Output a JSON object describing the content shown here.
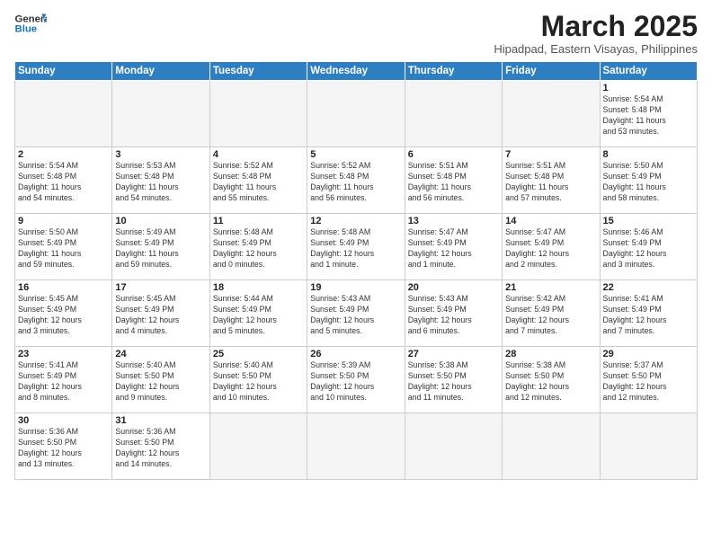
{
  "header": {
    "logo_general": "General",
    "logo_blue": "Blue",
    "month_title": "March 2025",
    "subtitle": "Hipadpad, Eastern Visayas, Philippines"
  },
  "days_of_week": [
    "Sunday",
    "Monday",
    "Tuesday",
    "Wednesday",
    "Thursday",
    "Friday",
    "Saturday"
  ],
  "weeks": [
    [
      {
        "num": "",
        "info": ""
      },
      {
        "num": "",
        "info": ""
      },
      {
        "num": "",
        "info": ""
      },
      {
        "num": "",
        "info": ""
      },
      {
        "num": "",
        "info": ""
      },
      {
        "num": "",
        "info": ""
      },
      {
        "num": "1",
        "info": "Sunrise: 5:54 AM\nSunset: 5:48 PM\nDaylight: 11 hours\nand 53 minutes."
      }
    ],
    [
      {
        "num": "2",
        "info": "Sunrise: 5:54 AM\nSunset: 5:48 PM\nDaylight: 11 hours\nand 54 minutes."
      },
      {
        "num": "3",
        "info": "Sunrise: 5:53 AM\nSunset: 5:48 PM\nDaylight: 11 hours\nand 54 minutes."
      },
      {
        "num": "4",
        "info": "Sunrise: 5:52 AM\nSunset: 5:48 PM\nDaylight: 11 hours\nand 55 minutes."
      },
      {
        "num": "5",
        "info": "Sunrise: 5:52 AM\nSunset: 5:48 PM\nDaylight: 11 hours\nand 56 minutes."
      },
      {
        "num": "6",
        "info": "Sunrise: 5:51 AM\nSunset: 5:48 PM\nDaylight: 11 hours\nand 56 minutes."
      },
      {
        "num": "7",
        "info": "Sunrise: 5:51 AM\nSunset: 5:48 PM\nDaylight: 11 hours\nand 57 minutes."
      },
      {
        "num": "8",
        "info": "Sunrise: 5:50 AM\nSunset: 5:49 PM\nDaylight: 11 hours\nand 58 minutes."
      }
    ],
    [
      {
        "num": "9",
        "info": "Sunrise: 5:50 AM\nSunset: 5:49 PM\nDaylight: 11 hours\nand 59 minutes."
      },
      {
        "num": "10",
        "info": "Sunrise: 5:49 AM\nSunset: 5:49 PM\nDaylight: 11 hours\nand 59 minutes."
      },
      {
        "num": "11",
        "info": "Sunrise: 5:48 AM\nSunset: 5:49 PM\nDaylight: 12 hours\nand 0 minutes."
      },
      {
        "num": "12",
        "info": "Sunrise: 5:48 AM\nSunset: 5:49 PM\nDaylight: 12 hours\nand 1 minute."
      },
      {
        "num": "13",
        "info": "Sunrise: 5:47 AM\nSunset: 5:49 PM\nDaylight: 12 hours\nand 1 minute."
      },
      {
        "num": "14",
        "info": "Sunrise: 5:47 AM\nSunset: 5:49 PM\nDaylight: 12 hours\nand 2 minutes."
      },
      {
        "num": "15",
        "info": "Sunrise: 5:46 AM\nSunset: 5:49 PM\nDaylight: 12 hours\nand 3 minutes."
      }
    ],
    [
      {
        "num": "16",
        "info": "Sunrise: 5:45 AM\nSunset: 5:49 PM\nDaylight: 12 hours\nand 3 minutes."
      },
      {
        "num": "17",
        "info": "Sunrise: 5:45 AM\nSunset: 5:49 PM\nDaylight: 12 hours\nand 4 minutes."
      },
      {
        "num": "18",
        "info": "Sunrise: 5:44 AM\nSunset: 5:49 PM\nDaylight: 12 hours\nand 5 minutes."
      },
      {
        "num": "19",
        "info": "Sunrise: 5:43 AM\nSunset: 5:49 PM\nDaylight: 12 hours\nand 5 minutes."
      },
      {
        "num": "20",
        "info": "Sunrise: 5:43 AM\nSunset: 5:49 PM\nDaylight: 12 hours\nand 6 minutes."
      },
      {
        "num": "21",
        "info": "Sunrise: 5:42 AM\nSunset: 5:49 PM\nDaylight: 12 hours\nand 7 minutes."
      },
      {
        "num": "22",
        "info": "Sunrise: 5:41 AM\nSunset: 5:49 PM\nDaylight: 12 hours\nand 7 minutes."
      }
    ],
    [
      {
        "num": "23",
        "info": "Sunrise: 5:41 AM\nSunset: 5:49 PM\nDaylight: 12 hours\nand 8 minutes."
      },
      {
        "num": "24",
        "info": "Sunrise: 5:40 AM\nSunset: 5:50 PM\nDaylight: 12 hours\nand 9 minutes."
      },
      {
        "num": "25",
        "info": "Sunrise: 5:40 AM\nSunset: 5:50 PM\nDaylight: 12 hours\nand 10 minutes."
      },
      {
        "num": "26",
        "info": "Sunrise: 5:39 AM\nSunset: 5:50 PM\nDaylight: 12 hours\nand 10 minutes."
      },
      {
        "num": "27",
        "info": "Sunrise: 5:38 AM\nSunset: 5:50 PM\nDaylight: 12 hours\nand 11 minutes."
      },
      {
        "num": "28",
        "info": "Sunrise: 5:38 AM\nSunset: 5:50 PM\nDaylight: 12 hours\nand 12 minutes."
      },
      {
        "num": "29",
        "info": "Sunrise: 5:37 AM\nSunset: 5:50 PM\nDaylight: 12 hours\nand 12 minutes."
      }
    ],
    [
      {
        "num": "30",
        "info": "Sunrise: 5:36 AM\nSunset: 5:50 PM\nDaylight: 12 hours\nand 13 minutes."
      },
      {
        "num": "31",
        "info": "Sunrise: 5:36 AM\nSunset: 5:50 PM\nDaylight: 12 hours\nand 14 minutes."
      },
      {
        "num": "",
        "info": ""
      },
      {
        "num": "",
        "info": ""
      },
      {
        "num": "",
        "info": ""
      },
      {
        "num": "",
        "info": ""
      },
      {
        "num": "",
        "info": ""
      }
    ]
  ]
}
